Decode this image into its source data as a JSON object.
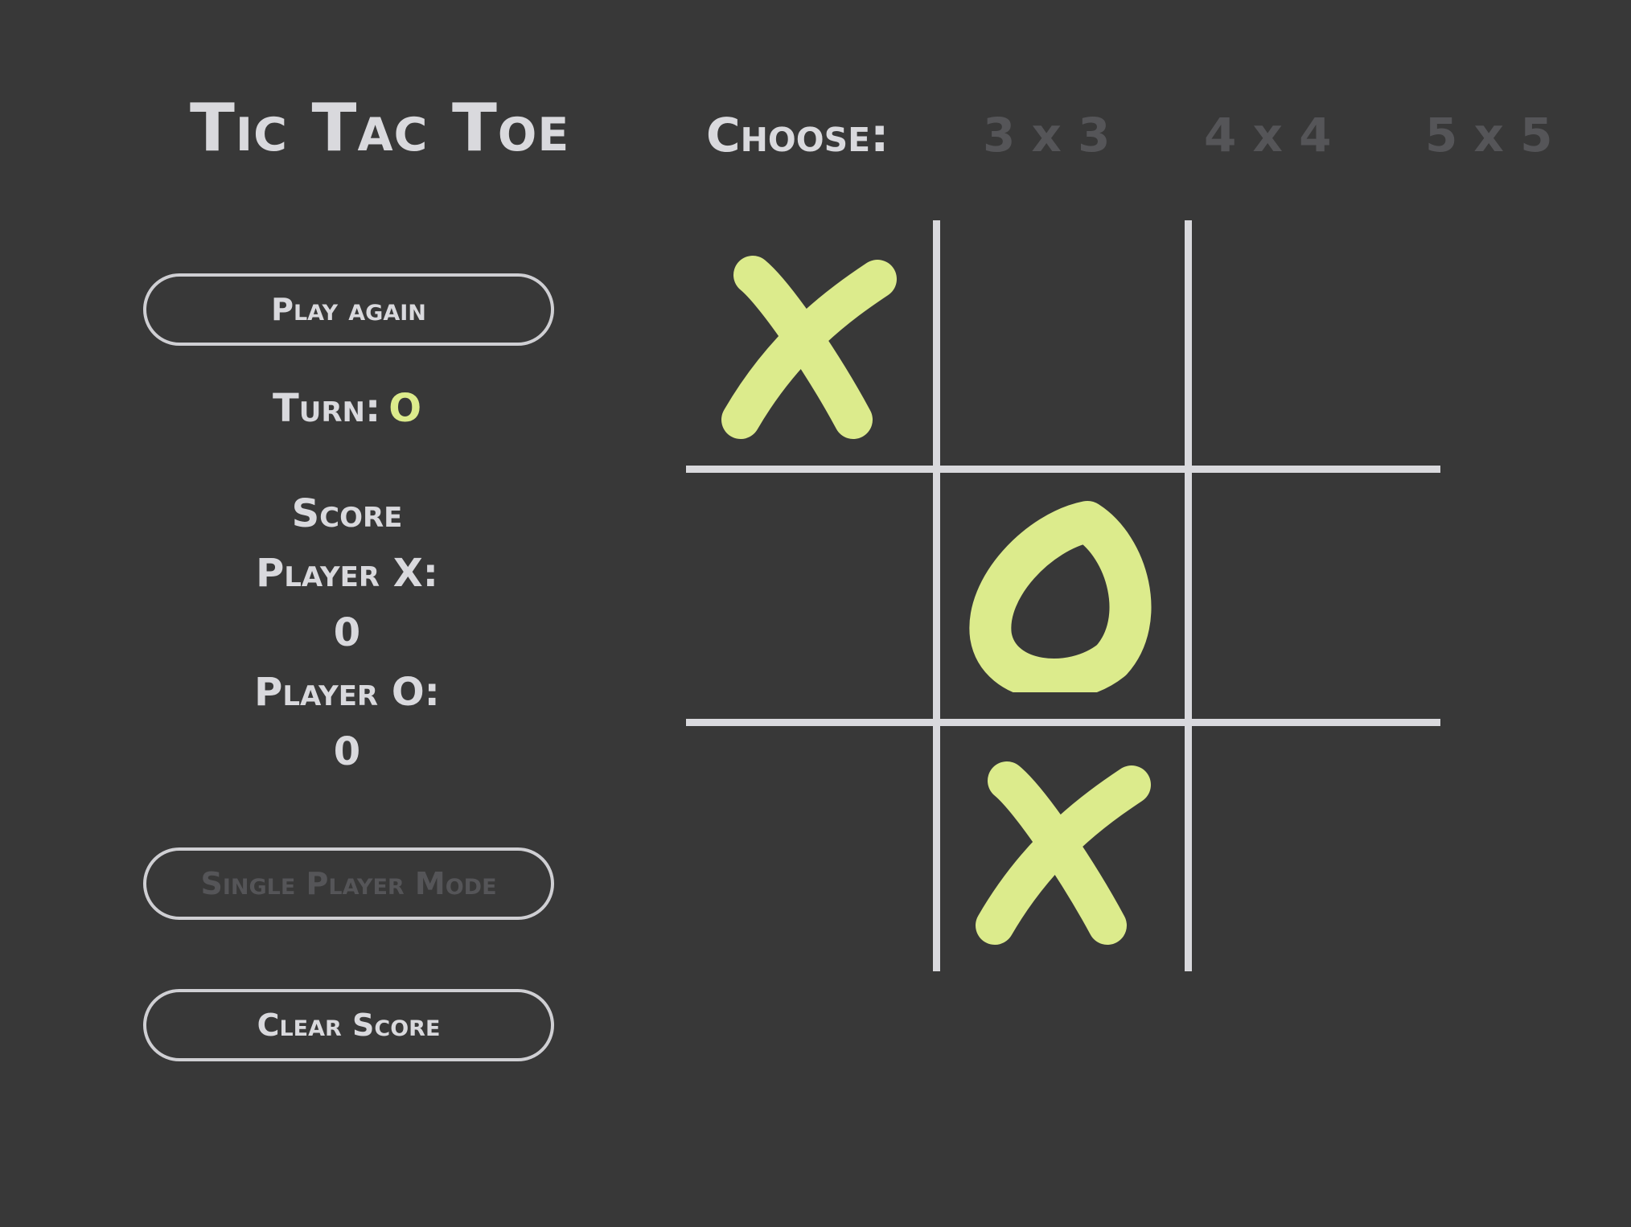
{
  "header": {
    "title": "Tic Tac Toe",
    "choose_label": "Choose:",
    "size_options": [
      "3 x 3",
      "4 x 4",
      "5 x 5"
    ]
  },
  "sidebar": {
    "play_again_label": "Play again",
    "turn_label": "Turn:",
    "turn_value": "O",
    "score_title": "Score",
    "player_x_label": "Player X:",
    "player_x_score": "0",
    "player_o_label": "Player O:",
    "player_o_score": "0",
    "single_player_label": "Single Player Mode",
    "clear_score_label": "Clear Score"
  },
  "board": {
    "size": 3,
    "cells": [
      "X",
      "",
      "",
      "",
      "O",
      "",
      "",
      "X",
      ""
    ]
  },
  "colors": {
    "background": "#383838",
    "text": "#d9d9dd",
    "accent": "#dceb8c",
    "disabled": "#555558"
  }
}
